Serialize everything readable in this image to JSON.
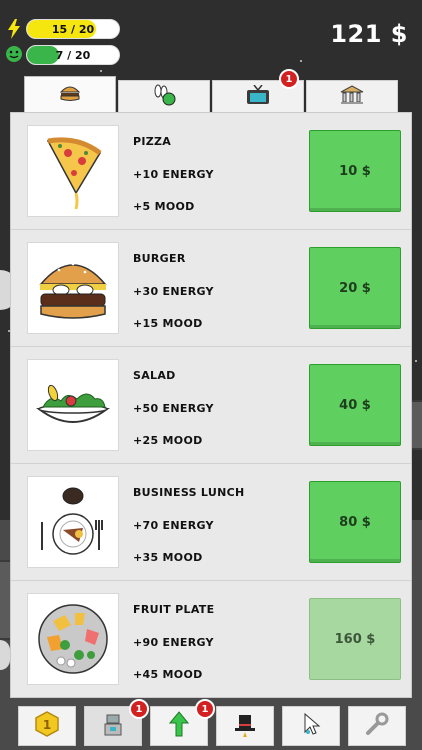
{
  "hud": {
    "energy_text": "15 / 20",
    "energy_fraction": 0.75,
    "energy_color": "#f6e60f",
    "mood_text": "7 / 20",
    "mood_fraction": 0.35,
    "mood_color": "#39b54a",
    "energy_icon": "lightning-icon",
    "mood_icon": "smiley-icon"
  },
  "money": "121 $",
  "tabs": [
    {
      "name": "food",
      "icon": "burger-icon",
      "active": true,
      "badge": ""
    },
    {
      "name": "bowling",
      "icon": "bowling-icon",
      "active": false,
      "badge": ""
    },
    {
      "name": "tv",
      "icon": "tv-icon",
      "active": false,
      "badge": "1"
    },
    {
      "name": "bank",
      "icon": "bank-icon",
      "active": false,
      "badge": ""
    }
  ],
  "items": [
    {
      "name": "PIZZA",
      "energy": "+10 ENERGY",
      "mood": "+5 MOOD",
      "price": "10 $",
      "icon": "pizza-icon",
      "affordable": true
    },
    {
      "name": "BURGER",
      "energy": "+30 ENERGY",
      "mood": "+15 MOOD",
      "price": "20 $",
      "icon": "burger-icon",
      "affordable": true
    },
    {
      "name": "SALAD",
      "energy": "+50 ENERGY",
      "mood": "+25 MOOD",
      "price": "40 $",
      "icon": "salad-icon",
      "affordable": true
    },
    {
      "name": "BUSINESS LUNCH",
      "energy": "+70 ENERGY",
      "mood": "+35 MOOD",
      "price": "80 $",
      "icon": "business-lunch-icon",
      "affordable": true
    },
    {
      "name": "FRUIT PLATE",
      "energy": "+90 ENERGY",
      "mood": "+45 MOOD",
      "price": "160 $",
      "icon": "fruit-plate-icon",
      "affordable": false
    }
  ],
  "bottom_bar": [
    {
      "name": "coin",
      "icon": "coin-icon",
      "badge": ""
    },
    {
      "name": "robot",
      "icon": "robot-icon",
      "badge": "1"
    },
    {
      "name": "upgrade",
      "icon": "up-arrow-icon",
      "badge": "1"
    },
    {
      "name": "magic",
      "icon": "magic-hat-icon",
      "badge": ""
    },
    {
      "name": "cursor",
      "icon": "cursor-icon",
      "badge": ""
    },
    {
      "name": "wrench",
      "icon": "wrench-icon",
      "badge": ""
    }
  ]
}
